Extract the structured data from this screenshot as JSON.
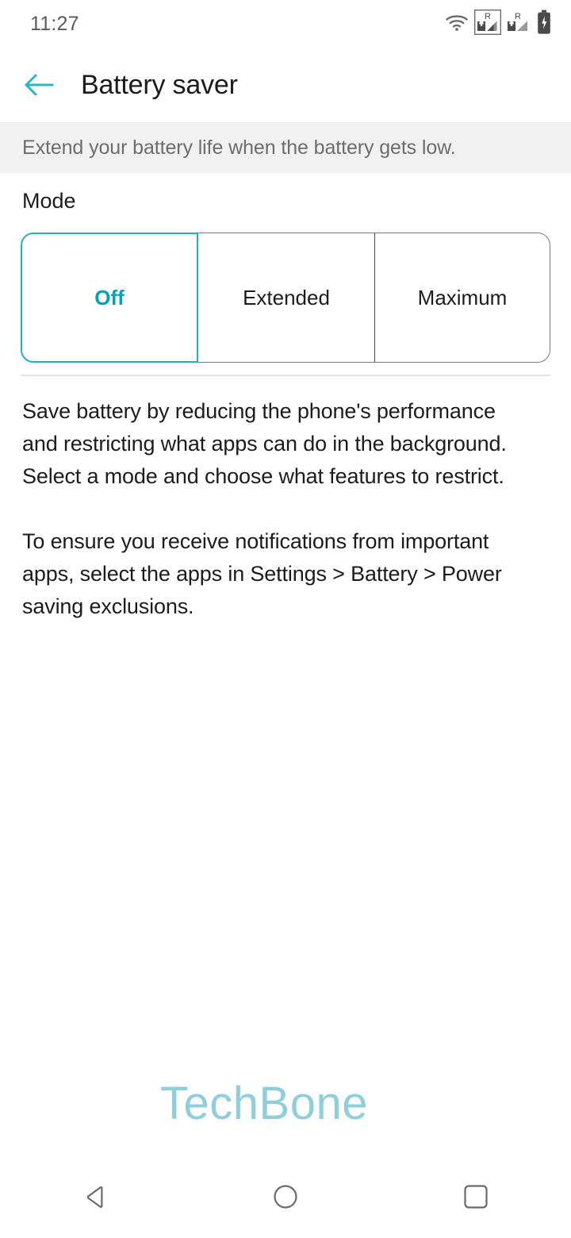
{
  "status_bar": {
    "clock": "11:27",
    "icons": [
      {
        "name": "wifi-icon",
        "label": "Wi-Fi"
      },
      {
        "name": "signal-sim1-roaming-icon",
        "label": "R"
      },
      {
        "name": "signal-sim2-roaming-icon",
        "label": "R"
      },
      {
        "name": "battery-icon",
        "label": "Battery"
      }
    ]
  },
  "app_bar": {
    "back_icon": "back-arrow-icon",
    "title": "Battery saver"
  },
  "info_banner": {
    "text": "Extend your battery life when the battery gets low."
  },
  "mode_section": {
    "label": "Mode",
    "selected": "Off",
    "options": [
      {
        "label": "Off",
        "selected": true
      },
      {
        "label": "Extended",
        "selected": false
      },
      {
        "label": "Maximum",
        "selected": false
      }
    ]
  },
  "description": {
    "paragraph_1": "Save battery by reducing the phone's performance and restricting what apps can do in the background. Select a mode and choose what features to restrict.",
    "paragraph_2": "To ensure you receive notifications from important apps, select the apps in Settings > Battery > Power saving exclusions."
  },
  "watermark": {
    "text": "TechBone"
  },
  "nav_bar": {
    "buttons": [
      {
        "name": "nav-back-button",
        "label": "Back"
      },
      {
        "name": "nav-home-button",
        "label": "Home"
      },
      {
        "name": "nav-recents-button",
        "label": "Recents"
      }
    ]
  },
  "colors": {
    "accent_teal": "#00a3b4",
    "segment_border_active": "#23b0bd",
    "banner_bg": "#f1f1f1",
    "watermark": "#8fcfdc",
    "text_primary": "#1c1c1c",
    "text_secondary": "#6d6d6d"
  }
}
